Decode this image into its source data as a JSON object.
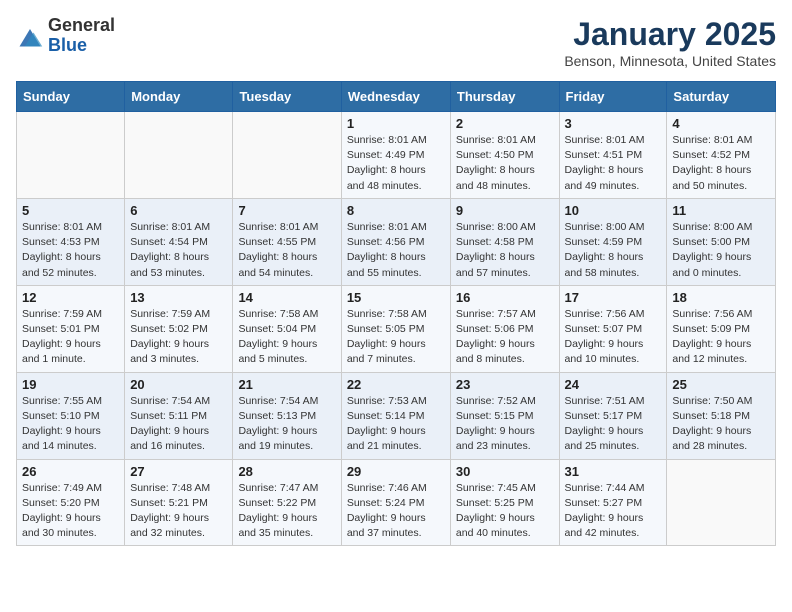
{
  "header": {
    "logo_general": "General",
    "logo_blue": "Blue",
    "month": "January 2025",
    "location": "Benson, Minnesota, United States"
  },
  "weekdays": [
    "Sunday",
    "Monday",
    "Tuesday",
    "Wednesday",
    "Thursday",
    "Friday",
    "Saturday"
  ],
  "weeks": [
    [
      {
        "day": "",
        "info": ""
      },
      {
        "day": "",
        "info": ""
      },
      {
        "day": "",
        "info": ""
      },
      {
        "day": "1",
        "info": "Sunrise: 8:01 AM\nSunset: 4:49 PM\nDaylight: 8 hours\nand 48 minutes."
      },
      {
        "day": "2",
        "info": "Sunrise: 8:01 AM\nSunset: 4:50 PM\nDaylight: 8 hours\nand 48 minutes."
      },
      {
        "day": "3",
        "info": "Sunrise: 8:01 AM\nSunset: 4:51 PM\nDaylight: 8 hours\nand 49 minutes."
      },
      {
        "day": "4",
        "info": "Sunrise: 8:01 AM\nSunset: 4:52 PM\nDaylight: 8 hours\nand 50 minutes."
      }
    ],
    [
      {
        "day": "5",
        "info": "Sunrise: 8:01 AM\nSunset: 4:53 PM\nDaylight: 8 hours\nand 52 minutes."
      },
      {
        "day": "6",
        "info": "Sunrise: 8:01 AM\nSunset: 4:54 PM\nDaylight: 8 hours\nand 53 minutes."
      },
      {
        "day": "7",
        "info": "Sunrise: 8:01 AM\nSunset: 4:55 PM\nDaylight: 8 hours\nand 54 minutes."
      },
      {
        "day": "8",
        "info": "Sunrise: 8:01 AM\nSunset: 4:56 PM\nDaylight: 8 hours\nand 55 minutes."
      },
      {
        "day": "9",
        "info": "Sunrise: 8:00 AM\nSunset: 4:58 PM\nDaylight: 8 hours\nand 57 minutes."
      },
      {
        "day": "10",
        "info": "Sunrise: 8:00 AM\nSunset: 4:59 PM\nDaylight: 8 hours\nand 58 minutes."
      },
      {
        "day": "11",
        "info": "Sunrise: 8:00 AM\nSunset: 5:00 PM\nDaylight: 9 hours\nand 0 minutes."
      }
    ],
    [
      {
        "day": "12",
        "info": "Sunrise: 7:59 AM\nSunset: 5:01 PM\nDaylight: 9 hours\nand 1 minute."
      },
      {
        "day": "13",
        "info": "Sunrise: 7:59 AM\nSunset: 5:02 PM\nDaylight: 9 hours\nand 3 minutes."
      },
      {
        "day": "14",
        "info": "Sunrise: 7:58 AM\nSunset: 5:04 PM\nDaylight: 9 hours\nand 5 minutes."
      },
      {
        "day": "15",
        "info": "Sunrise: 7:58 AM\nSunset: 5:05 PM\nDaylight: 9 hours\nand 7 minutes."
      },
      {
        "day": "16",
        "info": "Sunrise: 7:57 AM\nSunset: 5:06 PM\nDaylight: 9 hours\nand 8 minutes."
      },
      {
        "day": "17",
        "info": "Sunrise: 7:56 AM\nSunset: 5:07 PM\nDaylight: 9 hours\nand 10 minutes."
      },
      {
        "day": "18",
        "info": "Sunrise: 7:56 AM\nSunset: 5:09 PM\nDaylight: 9 hours\nand 12 minutes."
      }
    ],
    [
      {
        "day": "19",
        "info": "Sunrise: 7:55 AM\nSunset: 5:10 PM\nDaylight: 9 hours\nand 14 minutes."
      },
      {
        "day": "20",
        "info": "Sunrise: 7:54 AM\nSunset: 5:11 PM\nDaylight: 9 hours\nand 16 minutes."
      },
      {
        "day": "21",
        "info": "Sunrise: 7:54 AM\nSunset: 5:13 PM\nDaylight: 9 hours\nand 19 minutes."
      },
      {
        "day": "22",
        "info": "Sunrise: 7:53 AM\nSunset: 5:14 PM\nDaylight: 9 hours\nand 21 minutes."
      },
      {
        "day": "23",
        "info": "Sunrise: 7:52 AM\nSunset: 5:15 PM\nDaylight: 9 hours\nand 23 minutes."
      },
      {
        "day": "24",
        "info": "Sunrise: 7:51 AM\nSunset: 5:17 PM\nDaylight: 9 hours\nand 25 minutes."
      },
      {
        "day": "25",
        "info": "Sunrise: 7:50 AM\nSunset: 5:18 PM\nDaylight: 9 hours\nand 28 minutes."
      }
    ],
    [
      {
        "day": "26",
        "info": "Sunrise: 7:49 AM\nSunset: 5:20 PM\nDaylight: 9 hours\nand 30 minutes."
      },
      {
        "day": "27",
        "info": "Sunrise: 7:48 AM\nSunset: 5:21 PM\nDaylight: 9 hours\nand 32 minutes."
      },
      {
        "day": "28",
        "info": "Sunrise: 7:47 AM\nSunset: 5:22 PM\nDaylight: 9 hours\nand 35 minutes."
      },
      {
        "day": "29",
        "info": "Sunrise: 7:46 AM\nSunset: 5:24 PM\nDaylight: 9 hours\nand 37 minutes."
      },
      {
        "day": "30",
        "info": "Sunrise: 7:45 AM\nSunset: 5:25 PM\nDaylight: 9 hours\nand 40 minutes."
      },
      {
        "day": "31",
        "info": "Sunrise: 7:44 AM\nSunset: 5:27 PM\nDaylight: 9 hours\nand 42 minutes."
      },
      {
        "day": "",
        "info": ""
      }
    ]
  ]
}
